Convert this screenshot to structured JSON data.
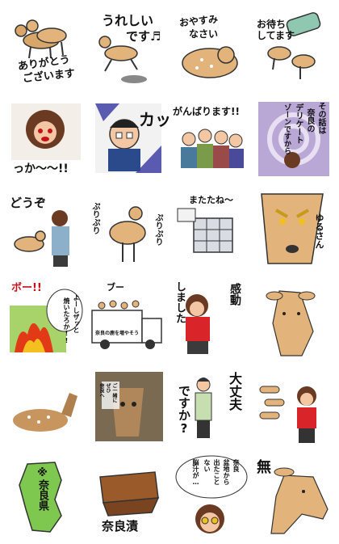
{
  "stickers": [
    {
      "lines": [
        "ありがとう",
        "ございます"
      ]
    },
    {
      "lines": [
        "うれしい",
        "です♬"
      ]
    },
    {
      "lines": [
        "おやすみ",
        "なさい"
      ]
    },
    {
      "lines": [
        "お待ち",
        "してます"
      ]
    },
    {
      "lines": [
        "っか〜〜!!"
      ]
    },
    {
      "lines": [
        "カッ!!"
      ]
    },
    {
      "lines": [
        "がんばります!!"
      ]
    },
    {
      "lines": [
        "その話は",
        "奈良の",
        "デリケート",
        "ゾーンですから"
      ]
    },
    {
      "lines": [
        "どうぞ"
      ]
    },
    {
      "lines": [
        "ぷりぷり",
        "ぷりぷり"
      ]
    },
    {
      "lines": [
        "またたね〜"
      ]
    },
    {
      "lines": [
        "ゆるさん"
      ]
    },
    {
      "lines": [
        "ボー!!",
        "よーしザッと",
        "焼いたろか!!"
      ]
    },
    {
      "lines": [
        "ブー",
        "奈良の鹿を増やそう"
      ]
    },
    {
      "lines": [
        "感動",
        "しました"
      ]
    },
    {
      "lines": []
    },
    {
      "lines": []
    },
    {
      "lines": [
        "ご一緒に",
        "ぜひ",
        "奈良へ"
      ]
    },
    {
      "lines": [
        "大丈夫",
        "ですか?"
      ]
    },
    {
      "lines": []
    },
    {
      "lines": [
        "※奈良県"
      ]
    },
    {
      "lines": [
        "奈良漬"
      ]
    },
    {
      "lines": [
        "奈良",
        "盆地から",
        "出たこと",
        "ない",
        "脳汁が…"
      ]
    },
    {
      "lines": [
        "無"
      ]
    }
  ]
}
